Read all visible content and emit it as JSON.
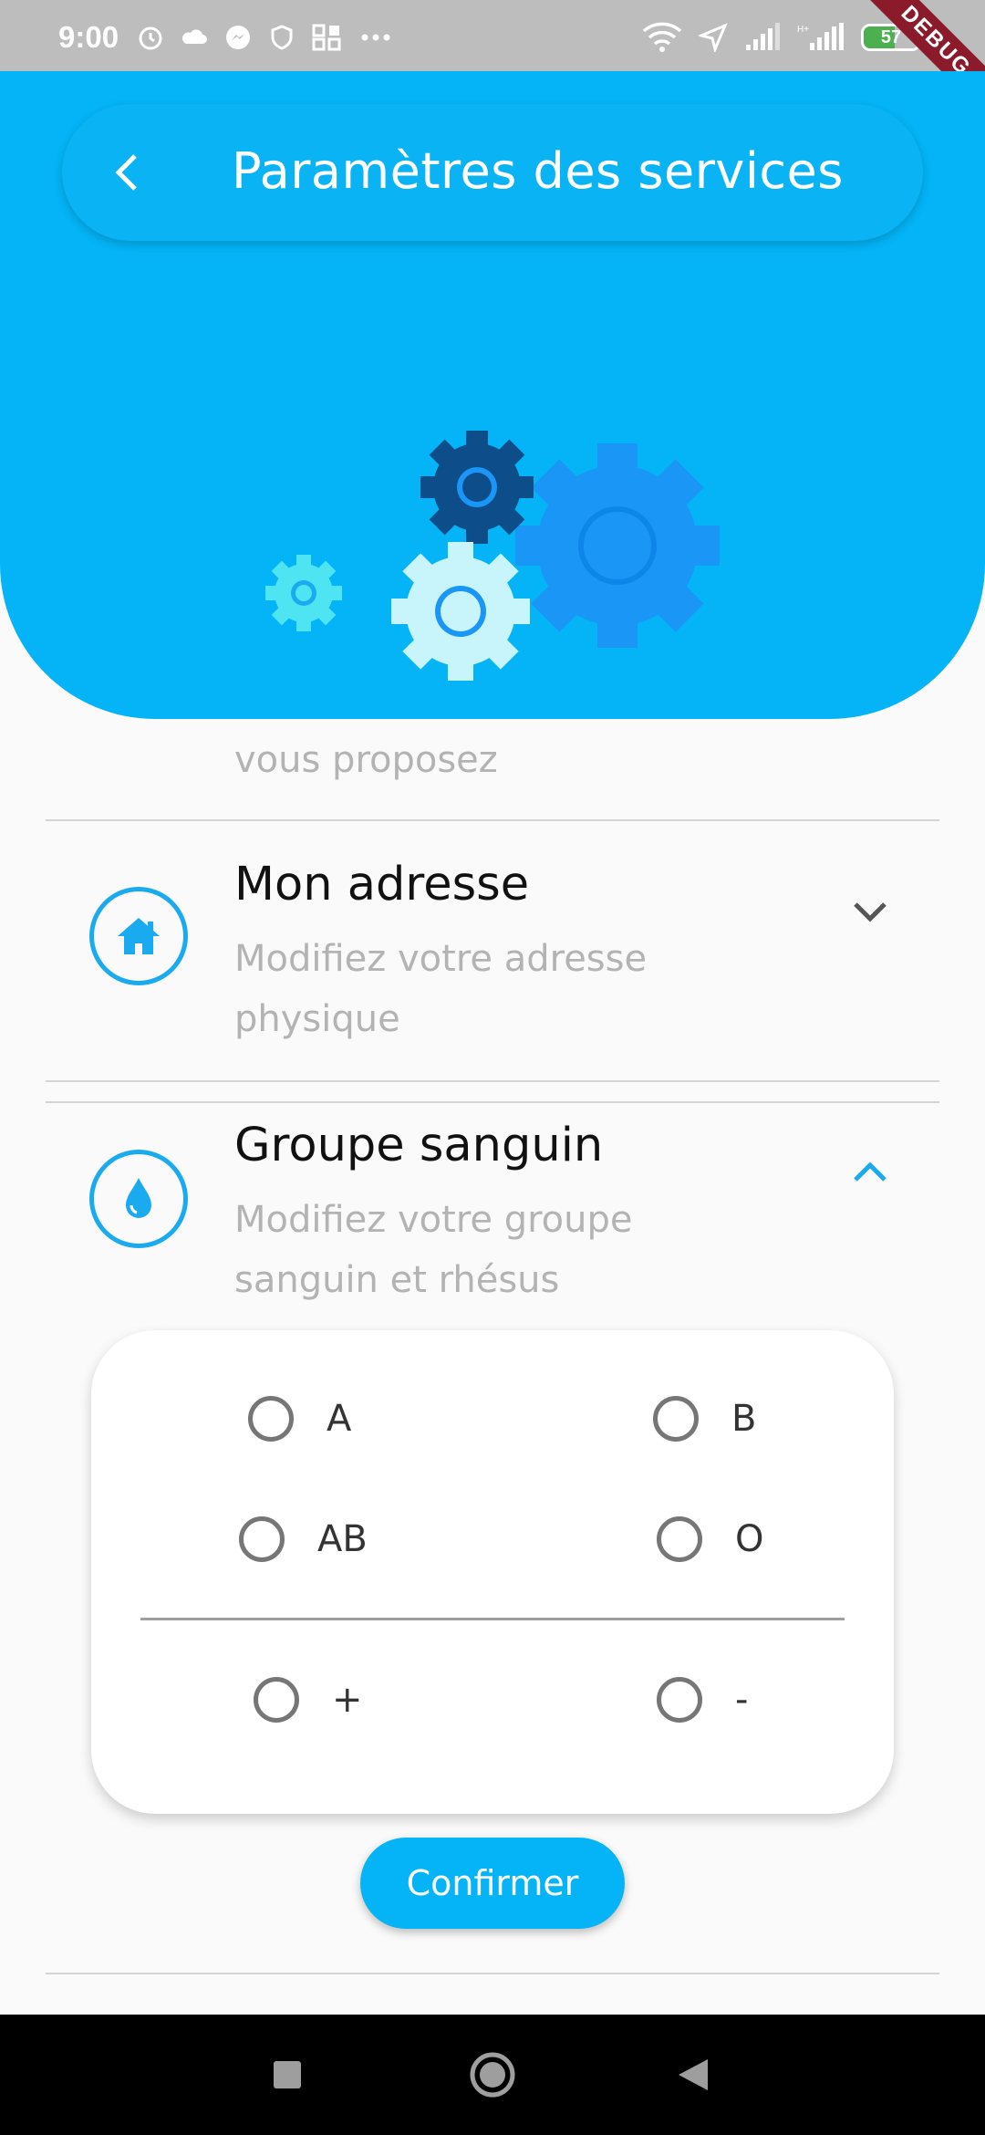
{
  "status_bar": {
    "time": "9:00",
    "battery_level": "57",
    "debug_label": "DEBUG",
    "left_icons": [
      "alarm-icon",
      "cloud-icon",
      "messenger-icon",
      "shield-icon",
      "grid-icon",
      "more-dots-icon"
    ],
    "right_icons": [
      "wifi-icon",
      "location-icon",
      "signal-icon",
      "signal-h-plus-icon",
      "battery-icon"
    ]
  },
  "header": {
    "title": "Paramètres des services",
    "back_icon": "chevron-left-icon",
    "illustration": "gears-illustration",
    "color": "#04b4f6"
  },
  "list": {
    "services_item": {
      "subtitle_tail": "vous proposez"
    },
    "address_item": {
      "title": "Mon adresse",
      "subtitle": "Modifiez votre adresse physique",
      "icon": "home-icon",
      "chevron": "chevron-down-icon"
    },
    "blood_item": {
      "title": "Groupe sanguin",
      "subtitle": "Modifiez votre groupe sanguin et rhésus",
      "icon": "water-drop-icon",
      "chevron": "chevron-up-icon"
    }
  },
  "blood_card": {
    "groups": [
      "A",
      "B",
      "AB",
      "O"
    ],
    "rhesus": [
      "+",
      "-"
    ]
  },
  "confirm_label": "Confirmer",
  "nav_bar": {
    "icons": [
      "recent-apps-icon",
      "home-circle-icon",
      "back-triangle-icon"
    ]
  },
  "colors": {
    "accent": "#04b4f6",
    "icon_ring": "#1aaaf0",
    "subtitle": "#b3b3b3"
  }
}
